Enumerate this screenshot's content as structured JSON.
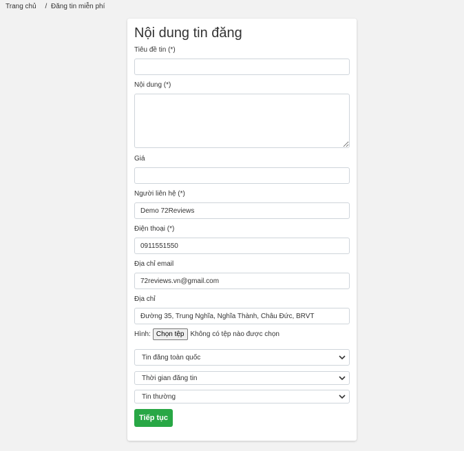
{
  "breadcrumb": {
    "home": "Trang chủ",
    "separator": "/",
    "current": "Đăng tin miễn phí"
  },
  "form": {
    "title": "Nội dung tin đăng",
    "fields": {
      "tieude": {
        "label": "Tiêu đề tin (*)",
        "value": "",
        "placeholder": ""
      },
      "noidung": {
        "label": "Nội dung (*)",
        "value": ""
      },
      "gia": {
        "label": "Giá",
        "value": ""
      },
      "nguoilienhe": {
        "label": "Người liên hệ (*)",
        "value": "Demo 72Reviews"
      },
      "dienthoai": {
        "label": "Điện thoại (*)",
        "value": "0911551550"
      },
      "email": {
        "label": "Địa chỉ email",
        "value": "72reviews.vn@gmail.com"
      },
      "diachi": {
        "label": "Địa chỉ",
        "value": "Đường 35, Trung Nghĩa, Nghĩa Thành, Châu Đức, BRVT"
      }
    },
    "image": {
      "label": "Hình:",
      "button": "Chọn tệp",
      "status": "Không có tệp nào được chọn"
    },
    "selects": {
      "scope": "Tin đăng toàn quốc",
      "duration": "Thời gian đăng tin",
      "type": "Tin thường"
    },
    "submit_label": "Tiếp tục"
  },
  "colors": {
    "submit_bg": "#28a745",
    "page_bg": "#f2f2f2",
    "border": "#ced4da"
  }
}
